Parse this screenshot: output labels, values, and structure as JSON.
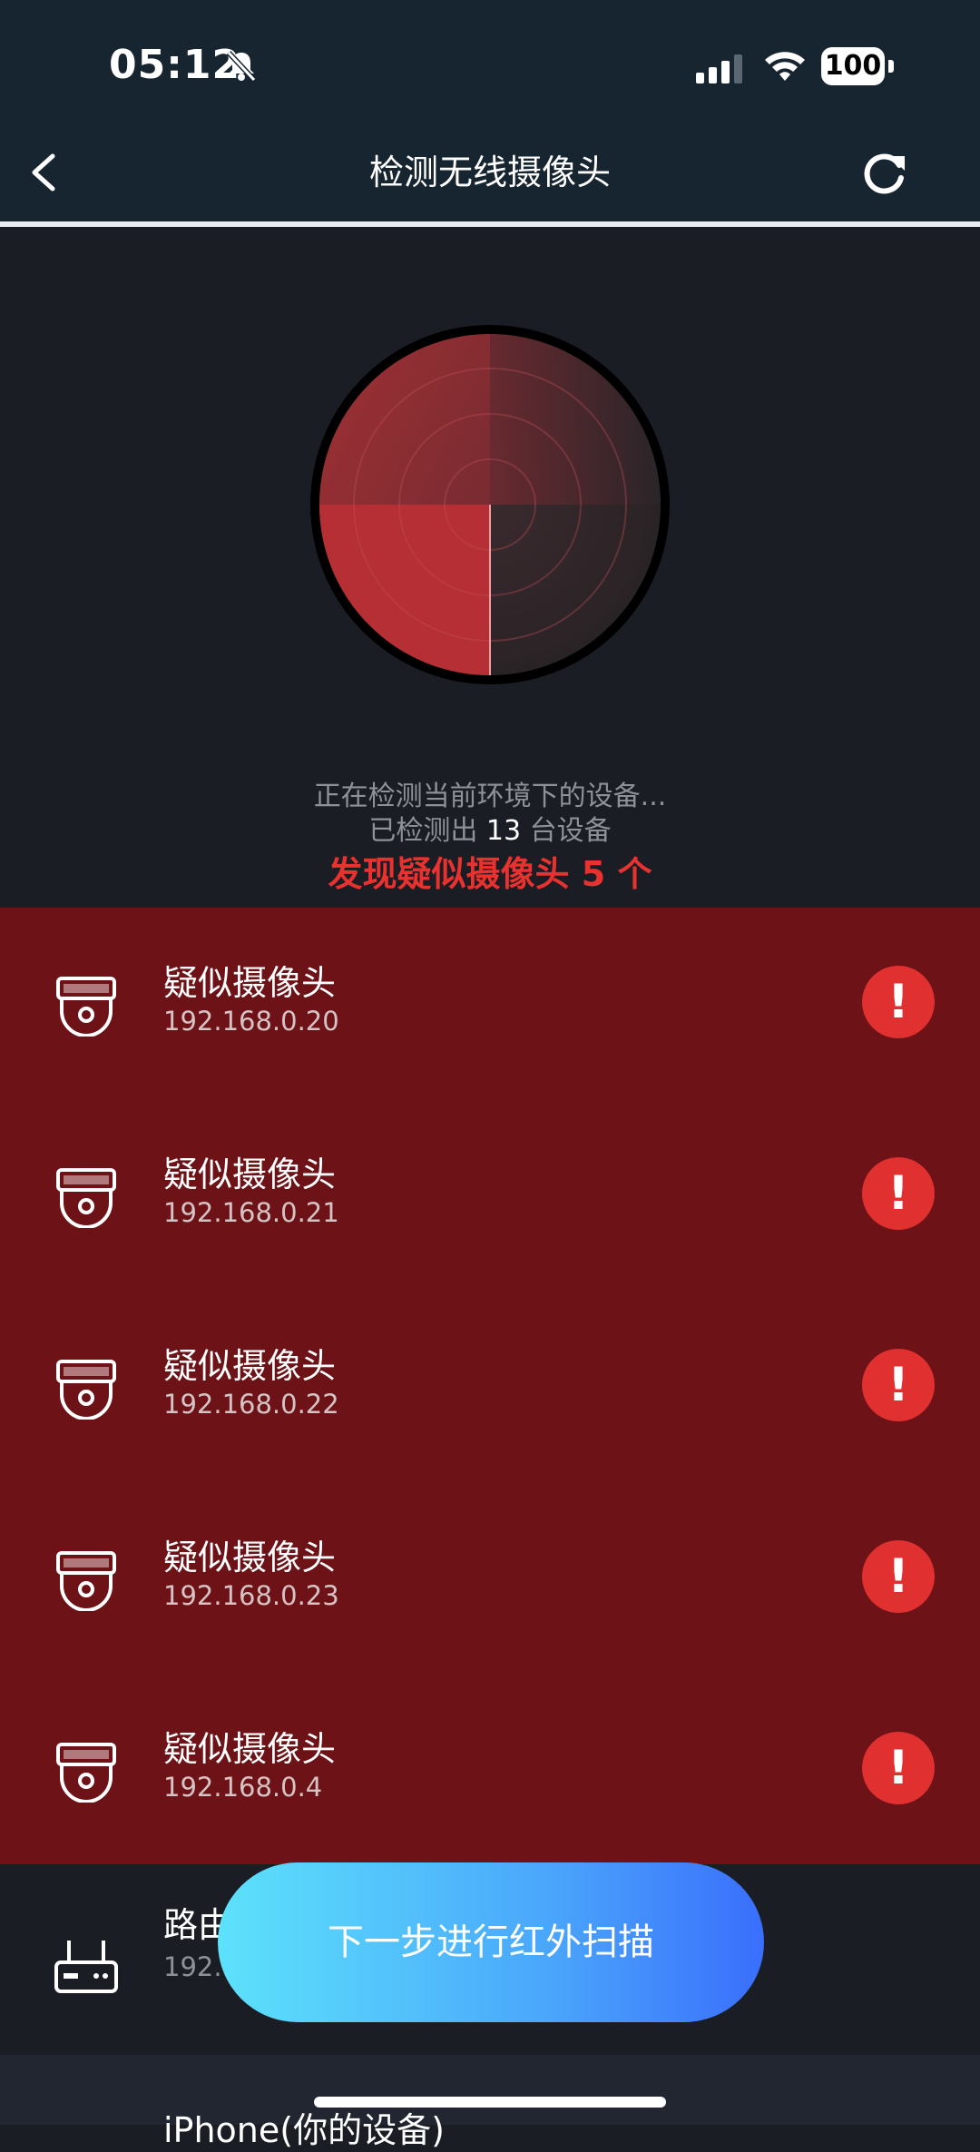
{
  "status_bar": {
    "time": "05:12",
    "battery": "100"
  },
  "nav": {
    "title": "检测无线摄像头"
  },
  "scan": {
    "status_line": "正在检测当前环境下的设备...",
    "count_prefix": "已检测出",
    "count": "13",
    "count_suffix": "台设备",
    "alert": "发现疑似摄像头 5 个"
  },
  "cameras": [
    {
      "name": "疑似摄像头",
      "ip": "192.168.0.20"
    },
    {
      "name": "疑似摄像头",
      "ip": "192.168.0.21"
    },
    {
      "name": "疑似摄像头",
      "ip": "192.168.0.22"
    },
    {
      "name": "疑似摄像头",
      "ip": "192.168.0.23"
    },
    {
      "name": "疑似摄像头",
      "ip": "192.168.0.4"
    }
  ],
  "warning_glyph": "!",
  "other_devices": [
    {
      "name": "路由",
      "ip": "192.1"
    },
    {
      "name": "iPhone(你的设备)"
    }
  ],
  "next_button_label": "下一步进行红外扫描",
  "colors": {
    "accent_red": "#e03030",
    "list_bg": "#6d1216",
    "button_start": "#5de2fb",
    "button_end": "#3a6efc"
  }
}
